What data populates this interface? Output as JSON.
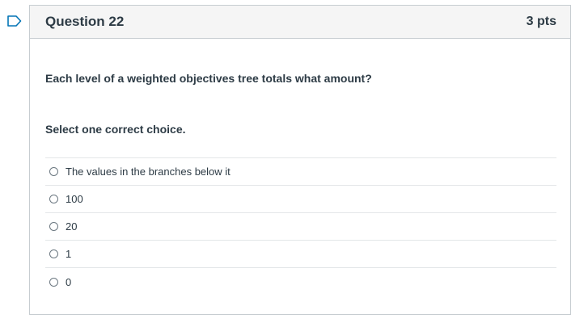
{
  "question": {
    "title": "Question 22",
    "points": "3 pts",
    "text": "Each level of a weighted objectives tree totals what amount?",
    "instruction": "Select one correct choice.",
    "flag_icon": "flag-outline-icon",
    "accent_color": "#0374b5"
  },
  "answers": [
    {
      "label": "The values in the branches below it"
    },
    {
      "label": "100"
    },
    {
      "label": "20"
    },
    {
      "label": "1"
    },
    {
      "label": "0"
    }
  ]
}
